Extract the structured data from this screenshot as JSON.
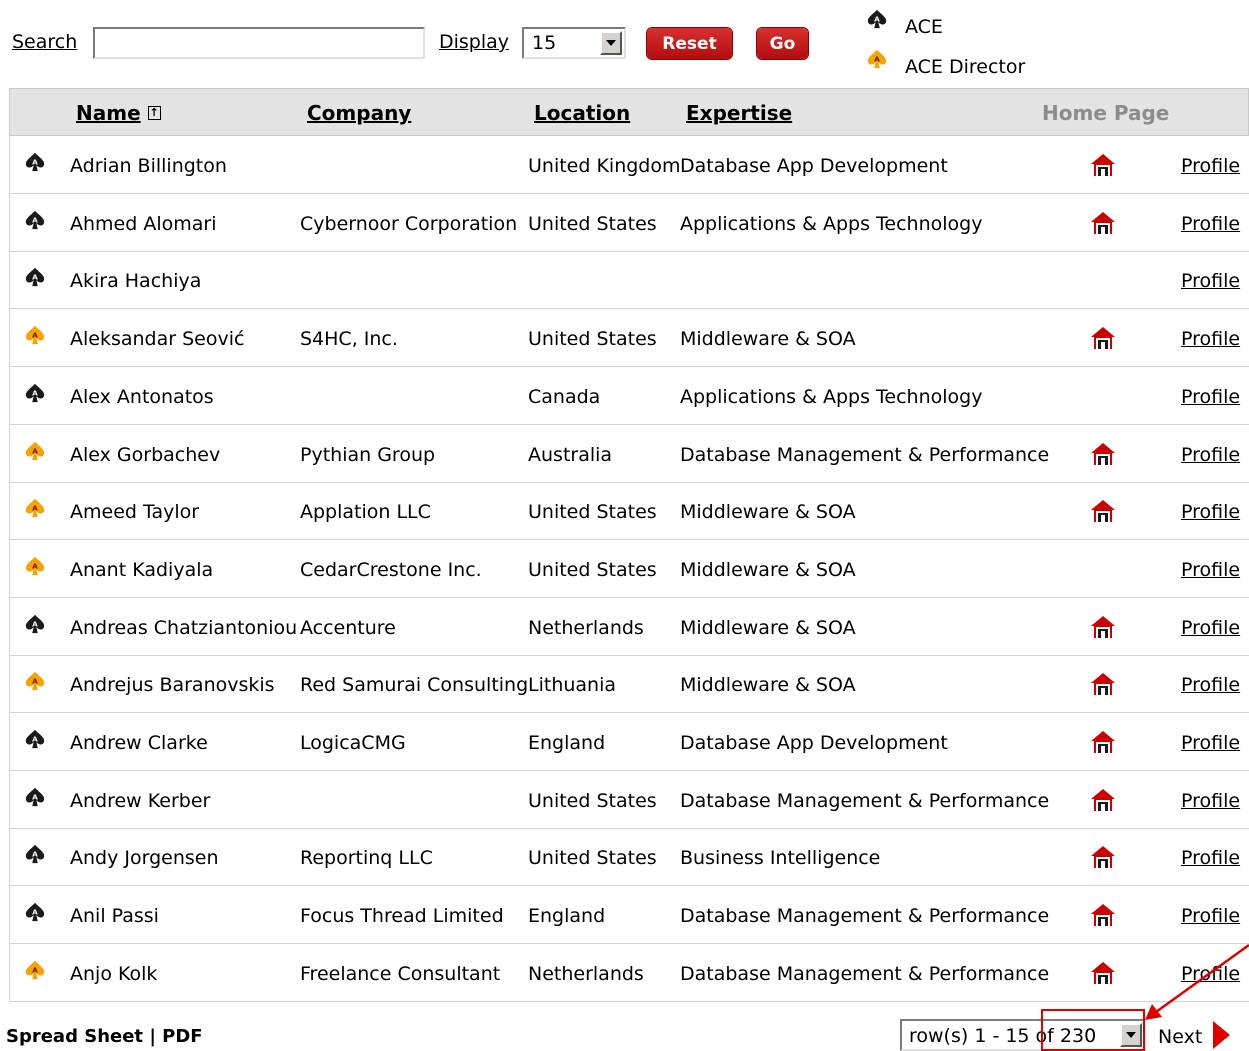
{
  "toolbar": {
    "search_label": "Search",
    "search_value": "",
    "display_label": "Display",
    "display_value": "15",
    "reset_label": "Reset",
    "go_label": "Go"
  },
  "legend": {
    "ace_label": "ACE",
    "director_label": "ACE Director"
  },
  "table": {
    "headers": {
      "name": "Name",
      "company": "Company",
      "location": "Location",
      "expertise": "Expertise",
      "home_page": "Home Page"
    },
    "rows": [
      {
        "type": "ace",
        "name": "Adrian Billington",
        "company": "",
        "location": "United Kingdom",
        "expertise": "Database App Development",
        "has_home": true,
        "profile": "Profile"
      },
      {
        "type": "ace",
        "name": "Ahmed Alomari",
        "company": "Cybernoor Corporation",
        "location": "United States",
        "expertise": "Applications & Apps Technology",
        "has_home": true,
        "profile": "Profile"
      },
      {
        "type": "ace",
        "name": "Akira Hachiya",
        "company": "",
        "location": "",
        "expertise": "",
        "has_home": false,
        "profile": "Profile"
      },
      {
        "type": "director",
        "name": "Aleksandar Seović",
        "company": "S4HC, Inc.",
        "location": "United States",
        "expertise": "Middleware & SOA",
        "has_home": true,
        "profile": "Profile"
      },
      {
        "type": "ace",
        "name": "Alex Antonatos",
        "company": "",
        "location": "Canada",
        "expertise": "Applications & Apps Technology",
        "has_home": false,
        "profile": "Profile"
      },
      {
        "type": "director",
        "name": "Alex Gorbachev",
        "company": "Pythian Group",
        "location": "Australia",
        "expertise": "Database Management & Performance",
        "has_home": true,
        "profile": "Profile"
      },
      {
        "type": "director",
        "name": "Ameed Taylor",
        "company": "Applation LLC",
        "location": "United States",
        "expertise": "Middleware & SOA",
        "has_home": true,
        "profile": "Profile"
      },
      {
        "type": "director",
        "name": "Anant Kadiyala",
        "company": "CedarCrestone Inc.",
        "location": "United States",
        "expertise": "Middleware & SOA",
        "has_home": false,
        "profile": "Profile"
      },
      {
        "type": "ace",
        "name": "Andreas Chatziantoniou",
        "company": "Accenture",
        "location": "Netherlands",
        "expertise": "Middleware & SOA",
        "has_home": true,
        "profile": "Profile"
      },
      {
        "type": "director",
        "name": "Andrejus Baranovskis",
        "company": "Red Samurai Consulting",
        "location": "Lithuania",
        "expertise": "Middleware & SOA",
        "has_home": true,
        "profile": "Profile"
      },
      {
        "type": "ace",
        "name": "Andrew Clarke",
        "company": "LogicaCMG",
        "location": "England",
        "expertise": "Database App Development",
        "has_home": true,
        "profile": "Profile"
      },
      {
        "type": "ace",
        "name": "Andrew Kerber",
        "company": "",
        "location": "United States",
        "expertise": "Database Management & Performance",
        "has_home": true,
        "profile": "Profile"
      },
      {
        "type": "ace",
        "name": "Andy Jorgensen",
        "company": "Reportinq LLC",
        "location": "United States",
        "expertise": "Business Intelligence",
        "has_home": true,
        "profile": "Profile"
      },
      {
        "type": "ace",
        "name": "Anil Passi",
        "company": "Focus Thread Limited",
        "location": "England",
        "expertise": "Database Management & Performance",
        "has_home": true,
        "profile": "Profile"
      },
      {
        "type": "director",
        "name": "Anjo Kolk",
        "company": "Freelance Consultant",
        "location": "Netherlands",
        "expertise": "Database Management & Performance",
        "has_home": true,
        "profile": "Profile"
      }
    ]
  },
  "footer": {
    "spreadsheet_label": "Spread Sheet",
    "separator": "|",
    "pdf_label": "PDF",
    "pager_value": "row(s) 1 - 15 of 230",
    "next_label": "Next"
  },
  "colors": {
    "button_red": "#c41a1a",
    "header_bg": "#e4e4e4",
    "director_orange": "#f5a300",
    "annotation_red": "#e00000"
  }
}
